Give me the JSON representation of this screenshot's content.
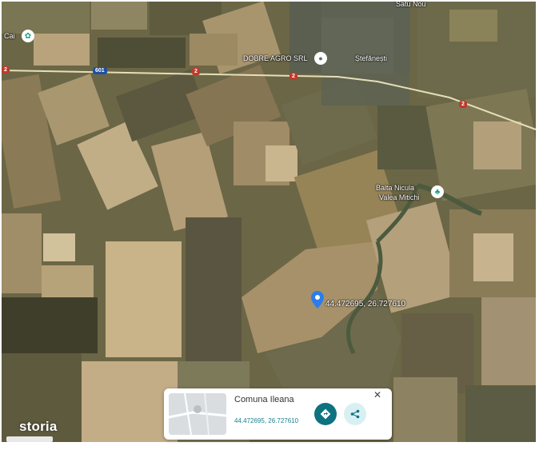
{
  "map": {
    "places": {
      "satu_nou": "Satu Nou",
      "cai": "Cai",
      "dobre_agro": "DOBRE AGRO SRL",
      "stefanesti": "Ștefănești",
      "balta_line1": "Balta Nicula",
      "balta_line2": "Valea Mitichi"
    },
    "road_shields": {
      "a": "2",
      "b": "601",
      "c": "2",
      "d": "2",
      "e": "2"
    },
    "pin_label": "44.472695, 26.727610"
  },
  "card": {
    "title": "Comuna Ileana",
    "coords": "44.472695, 26.727610",
    "close_symbol": "✕"
  },
  "brand": "storia",
  "colors": {
    "pin": "#2b7de9",
    "directions_button": "#0e7280",
    "share_button": "#d8f0f2",
    "poi_icon": "#1aa37a",
    "road": "#e6dfb8",
    "shield": "#c0392b"
  },
  "icons": {
    "pin": "location-pin-icon",
    "directions": "directions-icon",
    "share": "share-icon",
    "close": "close-icon",
    "poi": "place-marker-icon"
  }
}
